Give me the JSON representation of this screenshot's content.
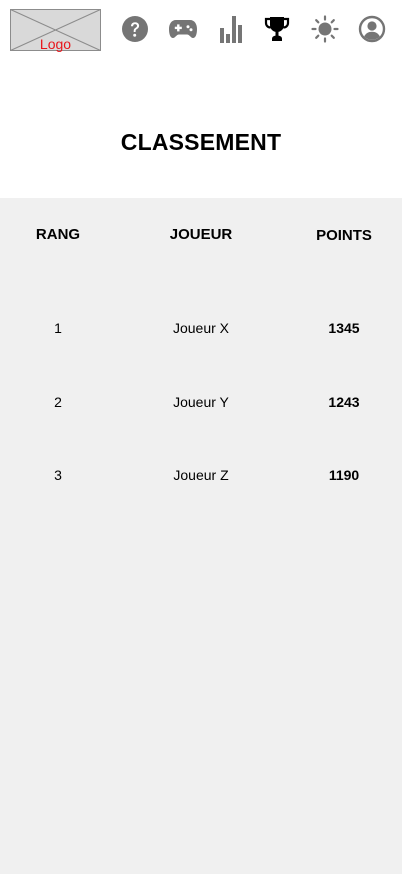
{
  "header": {
    "logo_label": "Logo",
    "nav": [
      {
        "name": "help-icon",
        "color": "#757575"
      },
      {
        "name": "gamepad-icon",
        "color": "#757575"
      },
      {
        "name": "bar-chart-icon",
        "color": "#757575"
      },
      {
        "name": "trophy-icon",
        "color": "#000000",
        "active": true
      },
      {
        "name": "brightness-icon",
        "color": "#757575"
      },
      {
        "name": "account-circle-icon",
        "color": "#757575"
      }
    ]
  },
  "page": {
    "title": "CLASSEMENT"
  },
  "leaderboard": {
    "columns": [
      "RANG",
      "JOUEUR",
      "POINTS"
    ],
    "rows": [
      {
        "rank": "1",
        "player": "Joueur X",
        "points": "1345"
      },
      {
        "rank": "2",
        "player": "Joueur Y",
        "points": "1243"
      },
      {
        "rank": "3",
        "player": "Joueur Z",
        "points": "1190"
      }
    ]
  },
  "colors": {
    "panel_bg": "#f0f0f0",
    "icon_gray": "#757575",
    "icon_active": "#000000",
    "logo_text": "#e8151b",
    "logo_bg": "#d9d9d9"
  }
}
